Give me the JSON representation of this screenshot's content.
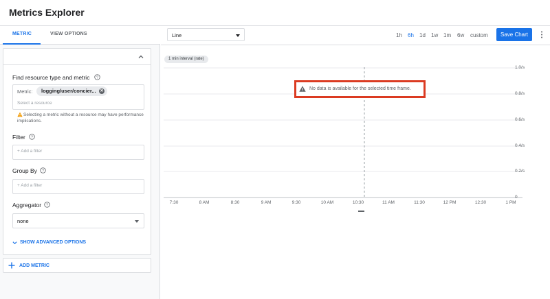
{
  "header": {
    "title": "Metrics Explorer"
  },
  "left": {
    "tabs": [
      {
        "label": "METRIC"
      },
      {
        "label": "VIEW OPTIONS"
      }
    ],
    "find_resource": {
      "label": "Find resource type and metric",
      "metric_prefix": "Metric:",
      "metric_chip": "logging/user/concier...",
      "resource_placeholder": "Select a resource",
      "warning": "Selecting a metric without a resource may have performance implications."
    },
    "filter": {
      "label": "Filter",
      "placeholder": "+ Add a filter"
    },
    "group_by": {
      "label": "Group By",
      "placeholder": "+ Add a filter"
    },
    "aggregator": {
      "label": "Aggregator",
      "value": "none"
    },
    "advanced_label": "SHOW ADVANCED OPTIONS",
    "add_metric_label": "ADD METRIC"
  },
  "toolbar": {
    "chart_type": "Line",
    "time_ranges": [
      "1h",
      "6h",
      "1d",
      "1w",
      "1m",
      "6w",
      "custom"
    ],
    "active_time_range": "6h",
    "save_label": "Save Chart"
  },
  "chart": {
    "interval_label": "1 min interval (rate)",
    "no_data_message": "No data is available for the selected time frame.",
    "y_ticks": [
      "1.0/s",
      "0.8/s",
      "0.6/s",
      "0.4/s",
      "0.2/s",
      "0"
    ],
    "x_ticks": [
      "7:30",
      "8 AM",
      "8:30",
      "9 AM",
      "9:30",
      "10 AM",
      "10:30",
      "11 AM",
      "11:30",
      "12 PM",
      "12:30",
      "1 PM"
    ]
  },
  "colors": {
    "accent": "#1a73e8",
    "highlight_border": "#db3b22",
    "warning": "#f29900"
  }
}
